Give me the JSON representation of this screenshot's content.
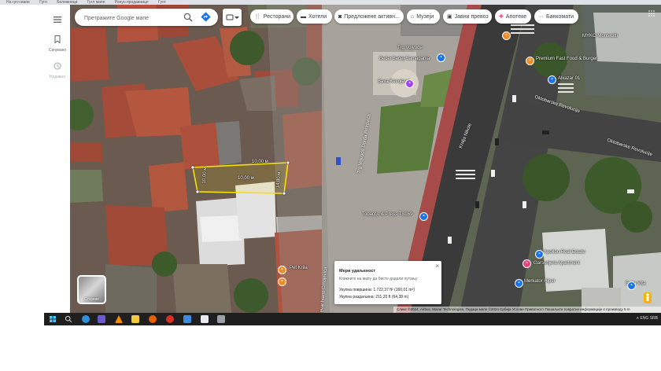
{
  "top_bar": {
    "tabs": [
      "На гугл мапе",
      "Гугл",
      "Бележници",
      "Гугл мапе",
      "Рачун продавнице",
      "Гугл"
    ]
  },
  "rail": {
    "menu_icon": "hamburger-menu-icon",
    "saved_label": "Сачувано",
    "recent_label": "Недавно"
  },
  "search": {
    "placeholder": "Претражите Google мапе",
    "icon": "search-icon",
    "directions_icon": "directions-icon"
  },
  "chips": [
    {
      "label": "Ресторани",
      "icon": "fork-knife-icon"
    },
    {
      "label": "Хотели",
      "icon": "bed-icon"
    },
    {
      "label": "Предложене активн...",
      "icon": "camera-icon"
    },
    {
      "label": "Музеји",
      "icon": "museum-icon"
    },
    {
      "label": "Јавни превоз",
      "icon": "transit-icon"
    },
    {
      "label": "Апотеке",
      "icon": "pharmacy-icon"
    },
    {
      "label": "Банкомати",
      "icon": "more-dots-icon"
    }
  ],
  "map_labels": {
    "place1": "Trg Vojvode",
    "place2": "Bečei Bečej-Samaganja",
    "place3": "Sava Kecojević",
    "place4": "Tobacco & Press TS169",
    "place5": "Pet Krila",
    "place6": "Premium Fast Food & Burger",
    "place7": "MYKO Montecitti",
    "place8": "Alkazar 01",
    "place9": "Apollon Real Estate",
    "place10": "Garsonjera Apartment",
    "place11": "Merkator Hiper",
    "place12": "Bella Vita",
    "road1": "Oktobarske Revolucije",
    "road2": "Kralja Nikole",
    "road3": "Trg Vojvode Dorđa Petrovića",
    "road4": "Oktobarske Revolucije",
    "road5": "Bulevar Ivana Crnojevića",
    "measure1": "10,00 м",
    "measure2": "14,80 м",
    "measure3": "10,00 м",
    "measure4": "10,00 м"
  },
  "layers": {
    "label": "Слојеви"
  },
  "measure_panel": {
    "title": "Мери удаљеност",
    "hint": "Кликните на мапу да бисте додали путању",
    "area": "Укупна површина: 1.722,37 ft² (160,01 m²)",
    "distance": "Укупна раздаљина: 211,20 ft (64,38 m)",
    "close": "×"
  },
  "attribution": "Слике ©2024, Airbus, Maxar Technologies, Подаци мапе ©2024    Србија    Услови    Приватност    Пошаљите повратне информације о производу    5 m",
  "taskbar": {
    "tray": "∧  ENG  SRB",
    "apps": [
      "windows-start-icon",
      "search-icon",
      "edge-icon",
      "save-icon",
      "vlc-icon",
      "folder-icon",
      "firefox-icon",
      "chrome-icon",
      "paint-icon",
      "docs-icon",
      "viewer-icon"
    ]
  },
  "colors": {
    "accent": "#1a73e8",
    "measure_outline": "#f5e100",
    "pin_orange": "#ee8c2a",
    "pin_blue": "#1a73e8",
    "pin_purple": "#a142f4",
    "pin_pink": "#e8427e"
  }
}
